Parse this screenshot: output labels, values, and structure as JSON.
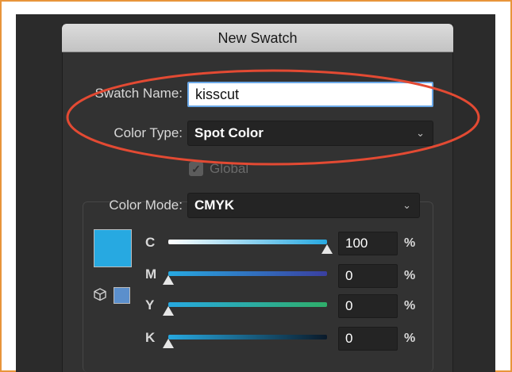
{
  "dialog": {
    "title": "New Swatch",
    "swatch_name_label": "Swatch Name:",
    "swatch_name_value": "kisscut",
    "color_type_label": "Color Type:",
    "color_type_value": "Spot Color",
    "global_label": "Global",
    "global_checked": true,
    "color_mode_label": "Color Mode:",
    "color_mode_value": "CMYK",
    "swatch_color": "#27a9e1",
    "web_swatch_color": "#5b8fcc",
    "sliders": [
      {
        "label": "C",
        "value": "100",
        "unit": "%",
        "level": 1.0
      },
      {
        "label": "M",
        "value": "0",
        "unit": "%",
        "level": 0.0
      },
      {
        "label": "Y",
        "value": "0",
        "unit": "%",
        "level": 0.0
      },
      {
        "label": "K",
        "value": "0",
        "unit": "%",
        "level": 0.0
      }
    ],
    "icons": {
      "dropdown": "chevron-down-icon",
      "checkbox": "checkmark-icon",
      "gamut": "cube-icon",
      "slider_thumb": "triangle-thumb-icon"
    }
  },
  "annotation": {
    "ellipse_color": "#e34a33"
  },
  "frame_color": "#e8953a"
}
